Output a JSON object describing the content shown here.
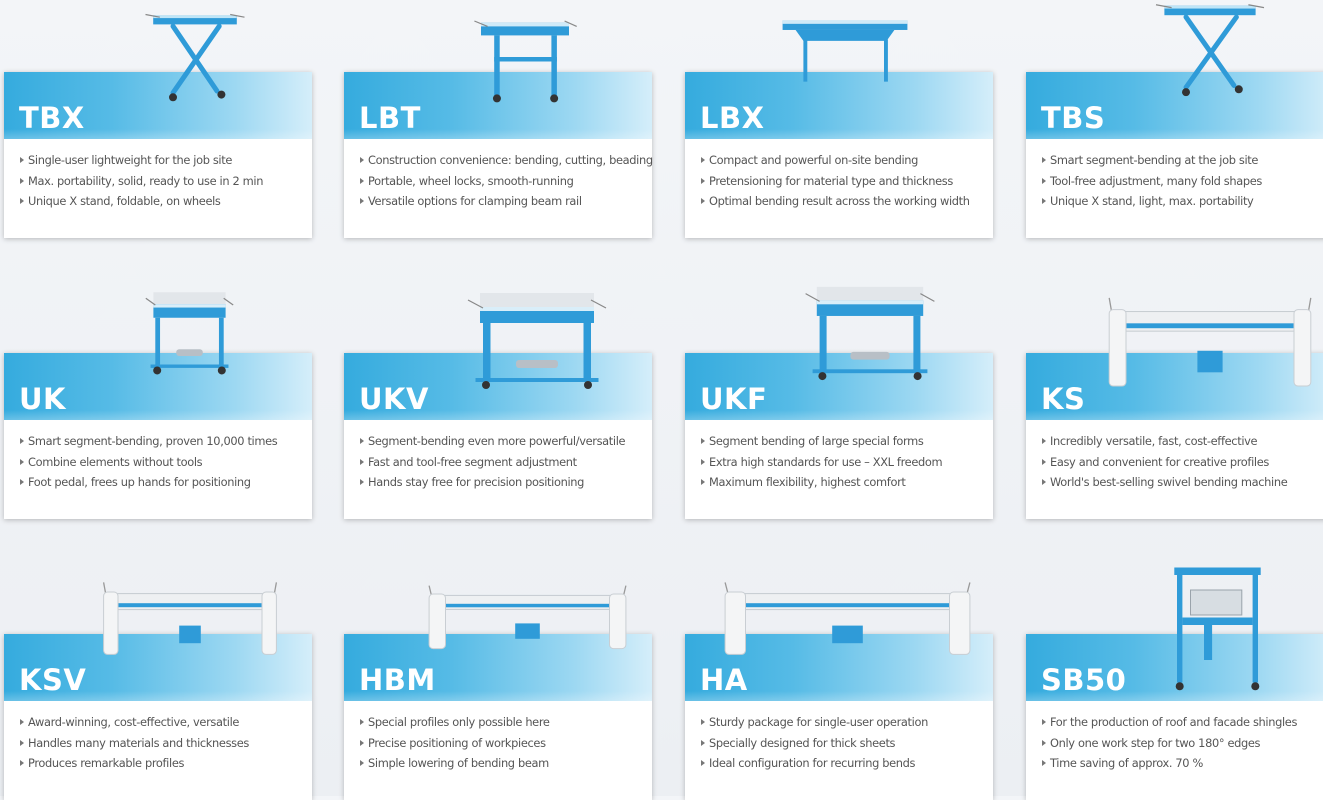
{
  "products": [
    {
      "title": "TBX",
      "bullets": [
        "Single-user lightweight for the job site",
        "Max. portability, solid, ready to use in 2 min",
        "Unique X stand, foldable, on wheels"
      ],
      "image": "x-stand-folder-image"
    },
    {
      "title": "LBT",
      "bullets": [
        "Construction convenience: bending, cutting, beading",
        "Portable, wheel locks, smooth-running",
        "Versatile options for clamping beam rail"
      ],
      "image": "folder-on-stand-image"
    },
    {
      "title": "LBX",
      "bullets": [
        "Compact and powerful on-site bending",
        "Pretensioning for material type and thickness",
        "Optimal bending result across the working width"
      ],
      "image": "wide-folder-image"
    },
    {
      "title": "TBS",
      "bullets": [
        "Smart segment-bending at the job site",
        "Tool-free adjustment, many fold shapes",
        "Unique X stand, light, max. portability"
      ],
      "image": "x-stand-segment-folder-image"
    },
    {
      "title": "UK",
      "bullets": [
        "Smart segment-bending, proven 10,000 times",
        "Combine elements without tools",
        "Foot pedal, frees up hands for positioning"
      ],
      "image": "segment-folder-image"
    },
    {
      "title": "UKV",
      "bullets": [
        "Segment-bending even more powerful/versatile",
        "Fast and tool-free segment adjustment",
        "Hands stay free for precision positioning"
      ],
      "image": "segment-folder-image"
    },
    {
      "title": "UKF",
      "bullets": [
        "Segment bending of large special forms",
        "Extra high standards for use – XXL freedom",
        "Maximum flexibility, highest comfort"
      ],
      "image": "segment-folder-image"
    },
    {
      "title": "KS",
      "bullets": [
        "Incredibly versatile, fast, cost-effective",
        "Easy and convenient for creative profiles",
        "World's best-selling swivel bending machine"
      ],
      "image": "swivel-bending-machine-image"
    },
    {
      "title": "KSV",
      "bullets": [
        "Award-winning, cost-effective, versatile",
        "Handles many materials and thicknesses",
        "Produces remarkable profiles"
      ],
      "image": "swivel-bending-machine-image"
    },
    {
      "title": "HBM",
      "bullets": [
        "Special profiles only possible here",
        "Precise positioning of workpieces",
        "Simple lowering of bending beam"
      ],
      "image": "swivel-bending-machine-image"
    },
    {
      "title": "HA",
      "bullets": [
        "Sturdy package for single-user operation",
        "Specially designed for thick sheets",
        "Ideal configuration for recurring bends"
      ],
      "image": "swivel-bending-machine-image"
    },
    {
      "title": "SB50",
      "bullets": [
        "For the production of roof and facade shingles",
        "Only one work step for two 180° edges",
        "Time saving of approx. 70 %"
      ],
      "image": "shingle-machine-image"
    }
  ],
  "colors": {
    "band_start": "#35abde",
    "band_end": "#d5eefa",
    "machine_blue": "#2f9bd8",
    "card_bg": "#ffffff",
    "text": "#555555"
  }
}
